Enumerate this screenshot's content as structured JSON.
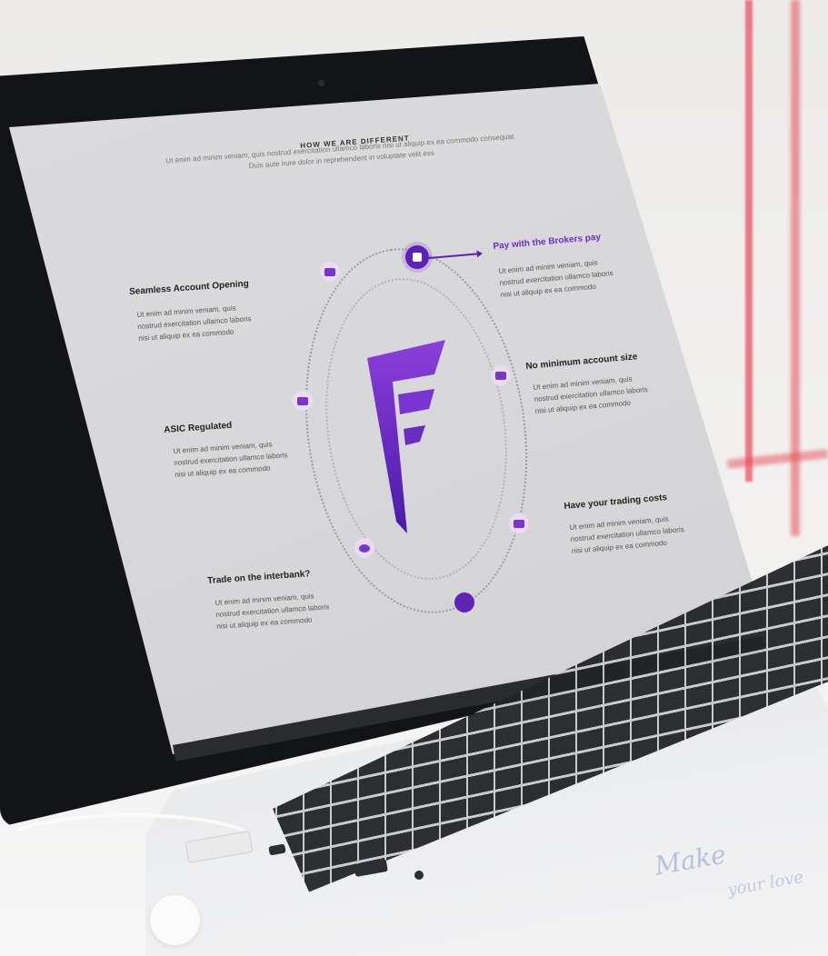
{
  "section": {
    "heading": "HOW WE ARE DIFFERENT",
    "subtitle": "Ut enim ad minim veniam, quis nostrud exercitation ullamco laboris nisi ut aliquip ex ea commodo consequat. Duis aute irure dolor in reprehenderit in voluptate velit ess"
  },
  "features_left": [
    {
      "title": "Seamless Account Opening",
      "desc": "Ut enim ad minim veniam, quis nostrud exercitation ullamco laboris nisi ut aliquip ex ea commodo"
    },
    {
      "title": "ASIC Regulated",
      "desc": "Ut enim ad minim veniam, quis nostrud exercitation ullamco laboris nisi ut aliquip ex ea commodo"
    },
    {
      "title": "Trade on the interbank?",
      "desc": "Ut enim ad minim veniam, quis nostrud exercitation ullamco laboris nisi ut aliquip ex ea commodo"
    }
  ],
  "features_right": [
    {
      "title": "Pay with the Brokers pay",
      "desc": "Ut enim ad minim veniam, quis nostrud exercitation ullamco laboris nisi ut aliquip ex ea commodo"
    },
    {
      "title": "No minimum account size",
      "desc": "Ut enim ad minim veniam, quis nostrud exercitation ullamco laboris nisi ut aliquip ex ea commodo"
    },
    {
      "title": "Have your trading costs",
      "desc": "Ut enim ad minim veniam, quis nostrud exercitation ullamco laboris nisi ut aliquip ex ea commodo"
    }
  ],
  "colors": {
    "accent": "#5e21b5",
    "accent_light": "#e9dcf6",
    "logo_top": "#8b3fd9",
    "logo_bottom": "#4a1aa8"
  },
  "icons": [
    "id-card-icon",
    "user-card-icon",
    "money-icon",
    "calculator-icon",
    "chart-icon",
    "cycle-icon"
  ],
  "sticker": {
    "line1": "Make",
    "line2": "your love"
  }
}
